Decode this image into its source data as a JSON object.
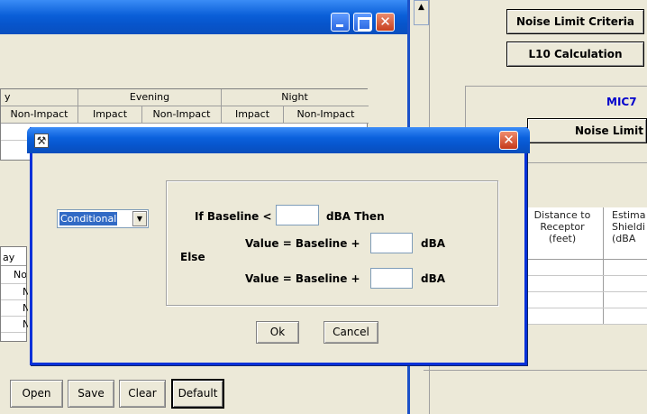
{
  "left_grid": {
    "groups": [
      "y",
      "Evening",
      "Night"
    ],
    "subheaders": [
      "Non-Impact",
      "Impact",
      "Non-Impact",
      "Impact",
      "Non-Impact"
    ]
  },
  "left_lower_grid": {
    "header": "ay",
    "rows": [
      "No",
      "N",
      "N",
      "N"
    ]
  },
  "bottom_buttons": {
    "open": "Open",
    "save": "Save",
    "clear": "Clear",
    "default": "Default"
  },
  "right_panel": {
    "noise_limit_criteria": "Noise Limit Criteria",
    "l10_calculation": "L10 Calculation",
    "mic_label": "MIC7",
    "noise_limit": "Noise Limit",
    "col_distance": "Distance to Receptor (feet)",
    "col_estimated": "Estima Shieldi (dBA"
  },
  "dialog": {
    "mode_select": "Conditional",
    "if_label": "If Baseline <",
    "then_label": "dBA Then",
    "value1_label": "Value = Baseline +",
    "dba1": "dBA",
    "else_label": "Else",
    "value2_label": "Value = Baseline +",
    "dba2": "dBA",
    "ok": "Ok",
    "cancel": "Cancel",
    "baseline_threshold": "",
    "value1": "",
    "value2": ""
  },
  "colors": {
    "titlebar": "#0755cc",
    "window_bg": "#ece9d8",
    "close_button": "#c5391a",
    "mic_label": "#0000cc"
  }
}
